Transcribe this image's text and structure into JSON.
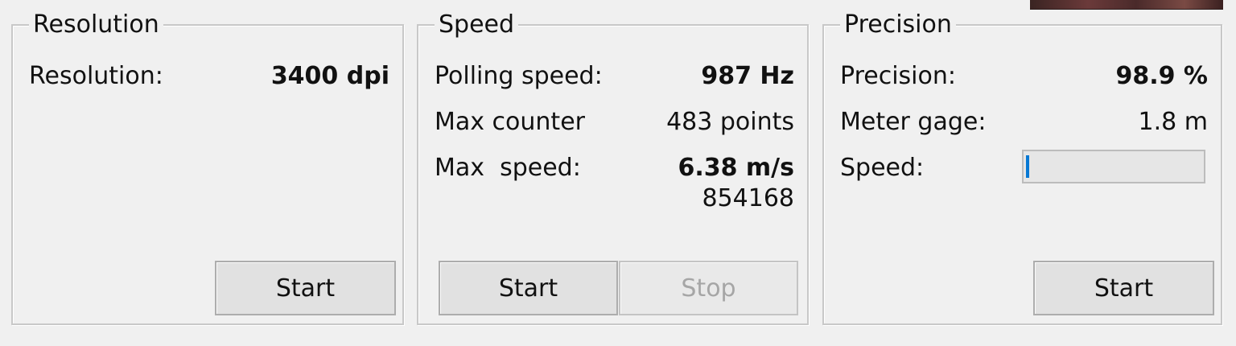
{
  "resolution_group": {
    "title": "Resolution",
    "resolution_label": "Resolution:",
    "resolution_value": "3400 dpi",
    "start_label": "Start"
  },
  "speed_group": {
    "title": "Speed",
    "polling_label": "Polling speed:",
    "polling_value": "987 Hz",
    "max_counter_label": "Max counter",
    "max_counter_value": "483 points",
    "max_speed_label": "Max  speed:",
    "max_speed_value": "6.38 m/s",
    "max_speed_raw": "854168",
    "start_label": "Start",
    "stop_label": "Stop"
  },
  "precision_group": {
    "title": "Precision",
    "precision_label": "Precision:",
    "precision_value": "98.9 %",
    "meter_gage_label": "Meter gage:",
    "meter_gage_value": "1.8 m",
    "speed_label": "Speed:",
    "speed_progress_fraction": 0.02,
    "start_label": "Start"
  },
  "colors": {
    "window_bg": "#f0f0f0",
    "progress_fill": "#0678d4",
    "disabled_text": "#a6a6a6"
  }
}
